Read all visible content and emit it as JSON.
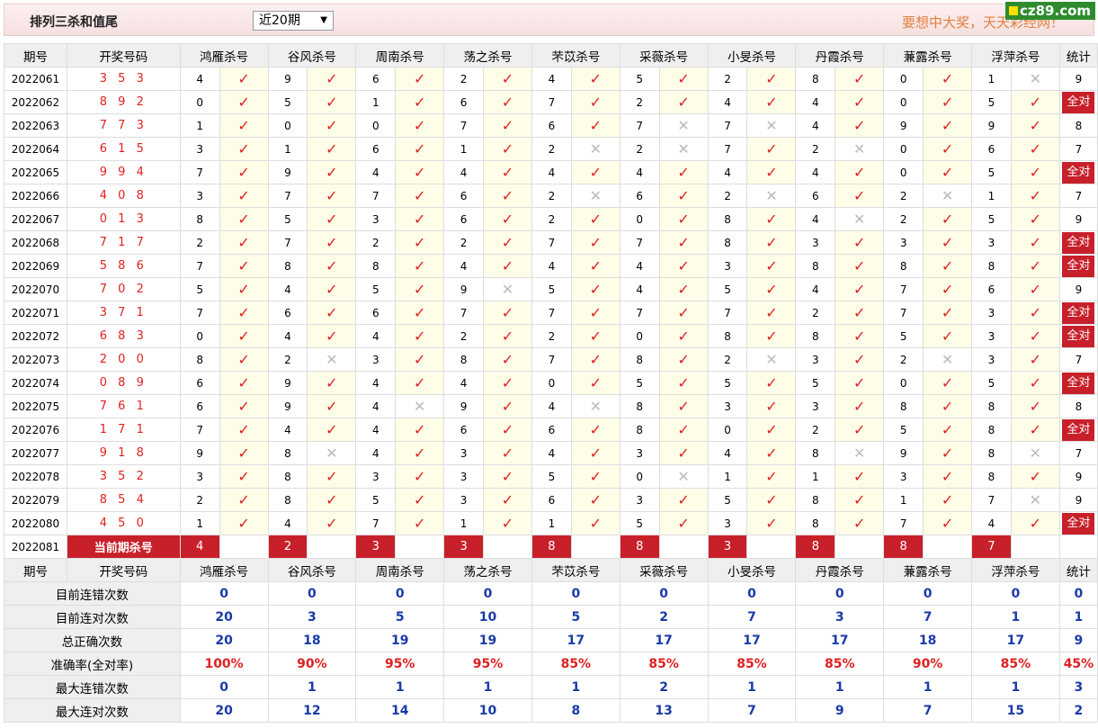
{
  "header": {
    "title": "排列三杀和值尾",
    "period_select": "近20期",
    "slogan": "要想中大奖，天天彩经网！",
    "logo": "cz89.com"
  },
  "columns": {
    "issue": "期号",
    "draw": "开奖号码",
    "experts": [
      "鸿雁杀号",
      "谷风杀号",
      "周南杀号",
      "荡之杀号",
      "芣苡杀号",
      "采薇杀号",
      "小旻杀号",
      "丹霞杀号",
      "蒹露杀号",
      "浮萍杀号"
    ],
    "stat": "统计"
  },
  "rows": [
    {
      "issue": "2022061",
      "draw": "3 5 3",
      "k": [
        4,
        9,
        6,
        2,
        4,
        5,
        2,
        8,
        0,
        1
      ],
      "ok": [
        1,
        1,
        1,
        1,
        1,
        1,
        1,
        1,
        1,
        0
      ],
      "stat": "9"
    },
    {
      "issue": "2022062",
      "draw": "8 9 2",
      "k": [
        0,
        5,
        1,
        6,
        7,
        2,
        4,
        4,
        0,
        5
      ],
      "ok": [
        1,
        1,
        1,
        1,
        1,
        1,
        1,
        1,
        1,
        1
      ],
      "stat": "全对"
    },
    {
      "issue": "2022063",
      "draw": "7 7 3",
      "k": [
        1,
        0,
        0,
        7,
        6,
        7,
        7,
        4,
        9,
        9
      ],
      "ok": [
        1,
        1,
        1,
        1,
        1,
        0,
        0,
        1,
        1,
        1
      ],
      "stat": "8"
    },
    {
      "issue": "2022064",
      "draw": "6 1 5",
      "k": [
        3,
        1,
        6,
        1,
        2,
        2,
        7,
        2,
        0,
        6
      ],
      "ok": [
        1,
        1,
        1,
        1,
        0,
        0,
        1,
        0,
        1,
        1
      ],
      "stat": "7"
    },
    {
      "issue": "2022065",
      "draw": "9 9 4",
      "k": [
        7,
        9,
        4,
        4,
        4,
        4,
        4,
        4,
        0,
        5
      ],
      "ok": [
        1,
        1,
        1,
        1,
        1,
        1,
        1,
        1,
        1,
        1
      ],
      "stat": "全对"
    },
    {
      "issue": "2022066",
      "draw": "4 0 8",
      "k": [
        3,
        7,
        7,
        6,
        2,
        6,
        2,
        6,
        2,
        1
      ],
      "ok": [
        1,
        1,
        1,
        1,
        0,
        1,
        0,
        1,
        0,
        1
      ],
      "stat": "7"
    },
    {
      "issue": "2022067",
      "draw": "0 1 3",
      "k": [
        8,
        5,
        3,
        6,
        2,
        0,
        8,
        4,
        2,
        5
      ],
      "ok": [
        1,
        1,
        1,
        1,
        1,
        1,
        1,
        0,
        1,
        1
      ],
      "stat": "9"
    },
    {
      "issue": "2022068",
      "draw": "7 1 7",
      "k": [
        2,
        7,
        2,
        2,
        7,
        7,
        8,
        3,
        3,
        3
      ],
      "ok": [
        1,
        1,
        1,
        1,
        1,
        1,
        1,
        1,
        1,
        1
      ],
      "stat": "全对"
    },
    {
      "issue": "2022069",
      "draw": "5 8 6",
      "k": [
        7,
        8,
        8,
        4,
        4,
        4,
        3,
        8,
        8,
        8
      ],
      "ok": [
        1,
        1,
        1,
        1,
        1,
        1,
        1,
        1,
        1,
        1
      ],
      "stat": "全对"
    },
    {
      "issue": "2022070",
      "draw": "7 0 2",
      "k": [
        5,
        4,
        5,
        9,
        5,
        4,
        5,
        4,
        7,
        6
      ],
      "ok": [
        1,
        1,
        1,
        0,
        1,
        1,
        1,
        1,
        1,
        1
      ],
      "stat": "9"
    },
    {
      "issue": "2022071",
      "draw": "3 7 1",
      "k": [
        7,
        6,
        6,
        7,
        7,
        7,
        7,
        2,
        7,
        3
      ],
      "ok": [
        1,
        1,
        1,
        1,
        1,
        1,
        1,
        1,
        1,
        1
      ],
      "stat": "全对"
    },
    {
      "issue": "2022072",
      "draw": "6 8 3",
      "k": [
        0,
        4,
        4,
        2,
        2,
        0,
        8,
        8,
        5,
        3
      ],
      "ok": [
        1,
        1,
        1,
        1,
        1,
        1,
        1,
        1,
        1,
        1
      ],
      "stat": "全对"
    },
    {
      "issue": "2022073",
      "draw": "2 0 0",
      "k": [
        8,
        2,
        3,
        8,
        7,
        8,
        2,
        3,
        2,
        3
      ],
      "ok": [
        1,
        0,
        1,
        1,
        1,
        1,
        0,
        1,
        0,
        1
      ],
      "stat": "7"
    },
    {
      "issue": "2022074",
      "draw": "0 8 9",
      "k": [
        6,
        9,
        4,
        4,
        0,
        5,
        5,
        5,
        0,
        5
      ],
      "ok": [
        1,
        1,
        1,
        1,
        1,
        1,
        1,
        1,
        1,
        1
      ],
      "stat": "全对"
    },
    {
      "issue": "2022075",
      "draw": "7 6 1",
      "k": [
        6,
        9,
        4,
        9,
        4,
        8,
        3,
        3,
        8,
        8
      ],
      "ok": [
        1,
        1,
        0,
        1,
        0,
        1,
        1,
        1,
        1,
        1
      ],
      "stat": "8"
    },
    {
      "issue": "2022076",
      "draw": "1 7 1",
      "k": [
        7,
        4,
        4,
        6,
        6,
        8,
        0,
        2,
        5,
        8
      ],
      "ok": [
        1,
        1,
        1,
        1,
        1,
        1,
        1,
        1,
        1,
        1
      ],
      "stat": "全对"
    },
    {
      "issue": "2022077",
      "draw": "9 1 8",
      "k": [
        9,
        8,
        4,
        3,
        4,
        3,
        4,
        8,
        9,
        8
      ],
      "ok": [
        1,
        0,
        1,
        1,
        1,
        1,
        1,
        0,
        1,
        0
      ],
      "stat": "7"
    },
    {
      "issue": "2022078",
      "draw": "3 5 2",
      "k": [
        3,
        8,
        3,
        3,
        5,
        0,
        1,
        1,
        3,
        8
      ],
      "ok": [
        1,
        1,
        1,
        1,
        1,
        0,
        1,
        1,
        1,
        1
      ],
      "stat": "9"
    },
    {
      "issue": "2022079",
      "draw": "8 5 4",
      "k": [
        2,
        8,
        5,
        3,
        6,
        3,
        5,
        8,
        1,
        7
      ],
      "ok": [
        1,
        1,
        1,
        1,
        1,
        1,
        1,
        1,
        1,
        0
      ],
      "stat": "9"
    },
    {
      "issue": "2022080",
      "draw": "4 5 0",
      "k": [
        1,
        4,
        7,
        1,
        1,
        5,
        3,
        8,
        7,
        4
      ],
      "ok": [
        1,
        1,
        1,
        1,
        1,
        1,
        1,
        1,
        1,
        1
      ],
      "stat": "全对"
    }
  ],
  "current": {
    "issue": "2022081",
    "label": "当前期杀号",
    "k": [
      4,
      2,
      3,
      3,
      8,
      8,
      3,
      8,
      8,
      7
    ]
  },
  "summary": [
    {
      "label": "目前连错次数",
      "vals": [
        "0",
        "0",
        "0",
        "0",
        "0",
        "0",
        "0",
        "0",
        "0",
        "0",
        "0"
      ],
      "red": false
    },
    {
      "label": "目前连对次数",
      "vals": [
        "20",
        "3",
        "5",
        "10",
        "5",
        "2",
        "7",
        "3",
        "7",
        "1",
        "1"
      ],
      "red": false
    },
    {
      "label": "总正确次数",
      "vals": [
        "20",
        "18",
        "19",
        "19",
        "17",
        "17",
        "17",
        "17",
        "18",
        "17",
        "9"
      ],
      "red": false
    },
    {
      "label": "准确率(全对率)",
      "vals": [
        "100%",
        "90%",
        "95%",
        "95%",
        "85%",
        "85%",
        "85%",
        "85%",
        "90%",
        "85%",
        "45%"
      ],
      "red": true
    },
    {
      "label": "最大连错次数",
      "vals": [
        "0",
        "1",
        "1",
        "1",
        "1",
        "2",
        "1",
        "1",
        "1",
        "1",
        "3"
      ],
      "red": false
    },
    {
      "label": "最大连对次数",
      "vals": [
        "20",
        "12",
        "14",
        "10",
        "8",
        "13",
        "7",
        "9",
        "7",
        "15",
        "2"
      ],
      "red": false
    }
  ],
  "icons": {
    "ok": "check-icon",
    "bad": "cross-icon"
  },
  "colors": {
    "accent_red": "#c8202a",
    "mark_red": "#e02020",
    "value_blue": "#1a3aa8",
    "slogan": "#e08040"
  }
}
